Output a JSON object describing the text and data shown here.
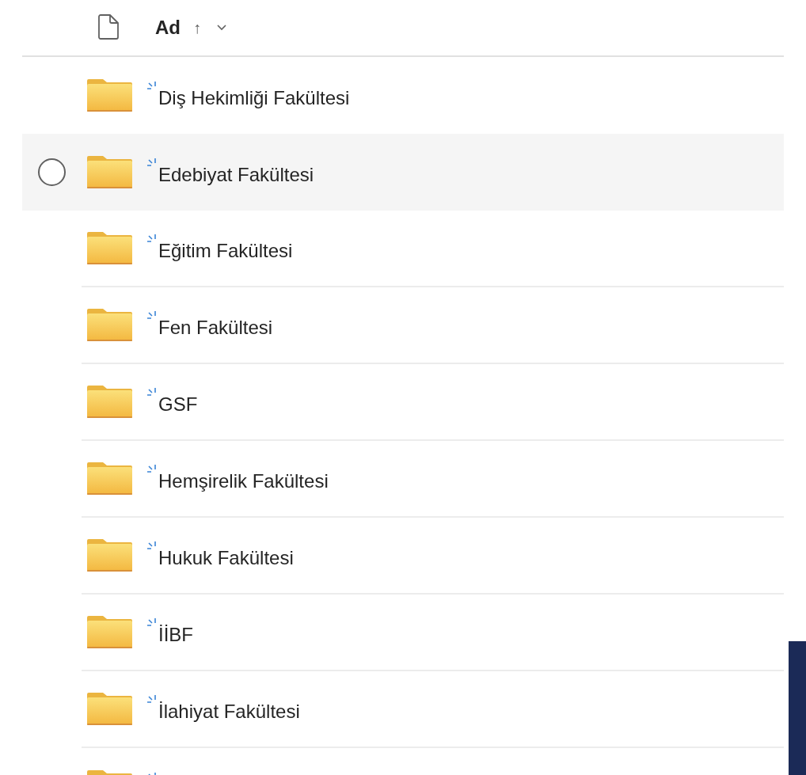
{
  "header": {
    "column_label": "Ad",
    "sort_arrow": "↑"
  },
  "rows": [
    {
      "name": "Diş Hekimliği Fakültesi",
      "hovered": false,
      "new": true
    },
    {
      "name": "Edebiyat Fakültesi",
      "hovered": true,
      "new": true
    },
    {
      "name": "Eğitim Fakültesi",
      "hovered": false,
      "new": true
    },
    {
      "name": "Fen Fakültesi",
      "hovered": false,
      "new": true
    },
    {
      "name": "GSF",
      "hovered": false,
      "new": true
    },
    {
      "name": "Hemşirelik Fakültesi",
      "hovered": false,
      "new": true
    },
    {
      "name": "Hukuk Fakültesi",
      "hovered": false,
      "new": true
    },
    {
      "name": "İİBF",
      "hovered": false,
      "new": true
    },
    {
      "name": "İlahiyat Fakültesi",
      "hovered": false,
      "new": true
    },
    {
      "hovered": false,
      "new": true
    }
  ]
}
